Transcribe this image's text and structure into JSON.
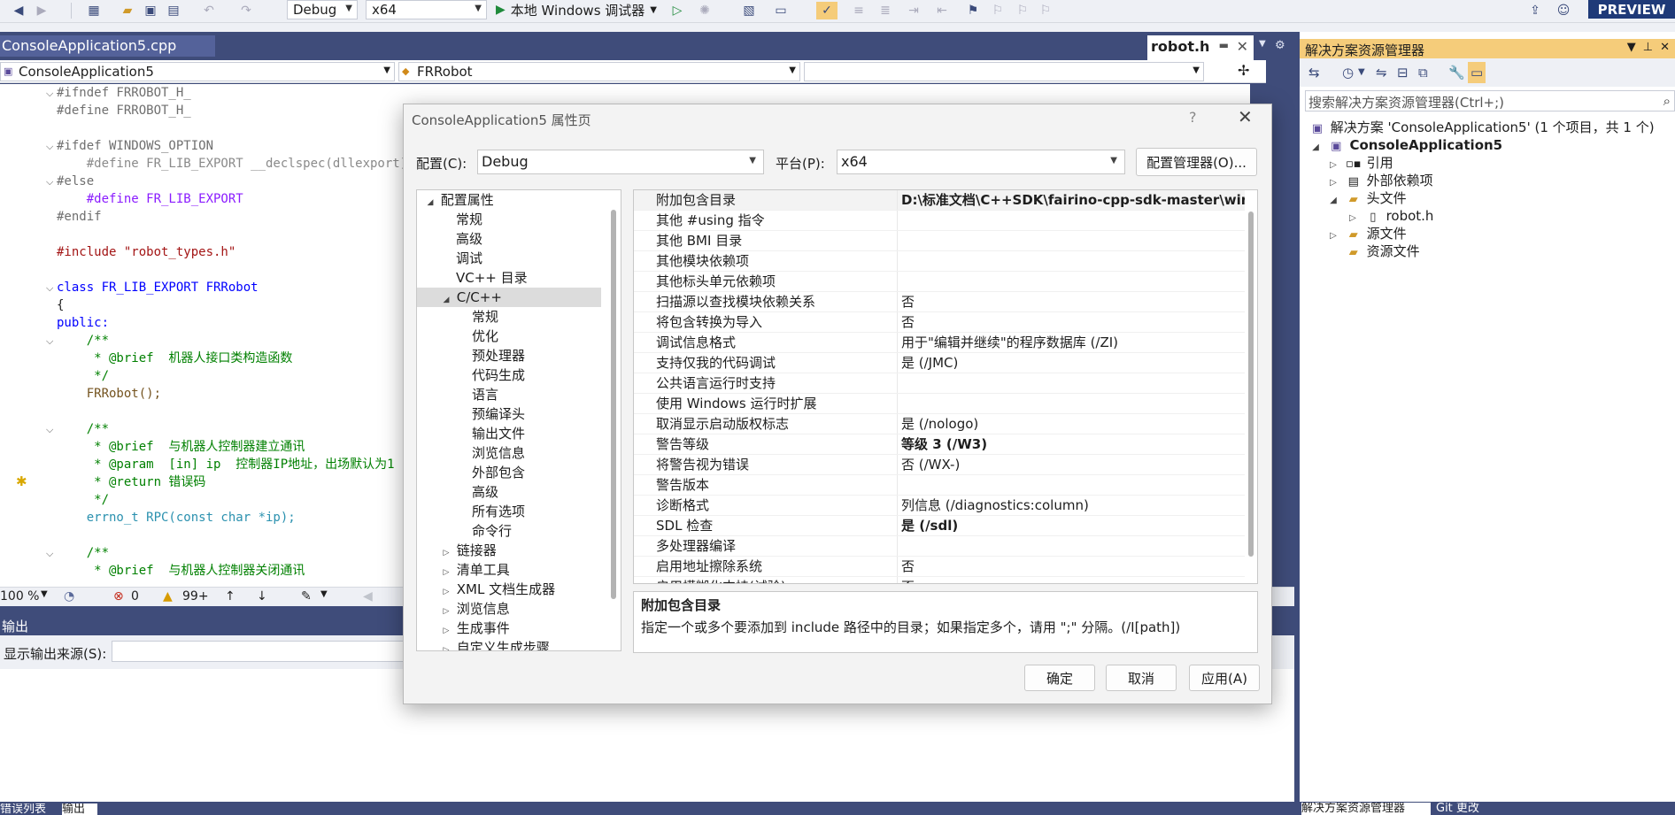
{
  "toolbar": {
    "config": "Debug",
    "platform": "x64",
    "debug_start": "本地 Windows 调试器",
    "preview": "PREVIEW"
  },
  "editor": {
    "tabs": {
      "main": "ConsoleApplication5.cpp",
      "robot": "robot.h"
    },
    "nav": {
      "project": "ConsoleApplication5",
      "scope": "FRRobot",
      "member": ""
    },
    "status": {
      "zoom": "100 %",
      "errors": "0",
      "warnings": "99+"
    }
  },
  "code": [
    "#ifndef FRROBOT_H_",
    "#define FRROBOT_H_",
    "",
    "#ifdef WINDOWS_OPTION",
    "    #define FR_LIB_EXPORT __declspec(dllexport)",
    "#else",
    "    #define FR_LIB_EXPORT",
    "#endif",
    "",
    "#include \"robot_types.h\"",
    "",
    "class FR_LIB_EXPORT FRRobot",
    "{",
    "public:",
    "    /**",
    "     * @brief  机器人接口类构造函数",
    "     */",
    "    FRRobot();",
    "",
    "    /**",
    "     * @brief  与机器人控制器建立通讯",
    "     * @param  [in] ip  控制器IP地址，出场默认为1",
    "     * @return 错误码",
    "     */",
    "    errno_t RPC(const char *ip);",
    "",
    "    /**",
    "     * @brief  与机器人控制器关闭通讯"
  ],
  "output": {
    "title": "输出",
    "source_label": "显示输出来源(S):",
    "tabs": [
      "错误列表",
      "输出"
    ]
  },
  "solution_explorer": {
    "title": "解决方案资源管理器",
    "search_placeholder": "搜索解决方案资源管理器(Ctrl+;)",
    "tree": [
      {
        "label": "解决方案 'ConsoleApplication5' (1 个项目，共 1 个)",
        "level": 0,
        "icon": "solution-icon"
      },
      {
        "label": "ConsoleApplication5",
        "level": 1,
        "icon": "project-icon",
        "expanded": true,
        "bold": true
      },
      {
        "label": "引用",
        "level": 2,
        "icon": "references-icon",
        "expanded": false
      },
      {
        "label": "外部依赖项",
        "level": 2,
        "icon": "external-deps-icon",
        "expanded": false
      },
      {
        "label": "头文件",
        "level": 2,
        "icon": "folder-icon",
        "expanded": true
      },
      {
        "label": "robot.h",
        "level": 3,
        "icon": "header-file-icon",
        "expanded": false
      },
      {
        "label": "源文件",
        "level": 2,
        "icon": "folder-icon",
        "expanded": false
      },
      {
        "label": "资源文件",
        "level": 2,
        "icon": "folder-icon"
      }
    ],
    "bottom_tabs": [
      "解决方案资源管理器",
      "Git 更改"
    ]
  },
  "dialog": {
    "title": "ConsoleApplication5 属性页",
    "config_label": "配置(C):",
    "config_value": "Debug",
    "platform_label": "平台(P):",
    "platform_value": "x64",
    "config_manager": "配置管理器(O)...",
    "tree": [
      {
        "label": "配置属性",
        "level": 0,
        "expanded": true
      },
      {
        "label": "常规",
        "level": 1
      },
      {
        "label": "高级",
        "level": 1
      },
      {
        "label": "调试",
        "level": 1
      },
      {
        "label": "VC++ 目录",
        "level": 1
      },
      {
        "label": "C/C++",
        "level": 1,
        "expanded": true,
        "selected": true
      },
      {
        "label": "常规",
        "level": 2
      },
      {
        "label": "优化",
        "level": 2
      },
      {
        "label": "预处理器",
        "level": 2
      },
      {
        "label": "代码生成",
        "level": 2
      },
      {
        "label": "语言",
        "level": 2
      },
      {
        "label": "预编译头",
        "level": 2
      },
      {
        "label": "输出文件",
        "level": 2
      },
      {
        "label": "浏览信息",
        "level": 2
      },
      {
        "label": "外部包含",
        "level": 2
      },
      {
        "label": "高级",
        "level": 2
      },
      {
        "label": "所有选项",
        "level": 2
      },
      {
        "label": "命令行",
        "level": 2
      },
      {
        "label": "链接器",
        "level": 1,
        "expanded": false
      },
      {
        "label": "清单工具",
        "level": 1,
        "expanded": false
      },
      {
        "label": "XML 文档生成器",
        "level": 1,
        "expanded": false
      },
      {
        "label": "浏览信息",
        "level": 1,
        "expanded": false
      },
      {
        "label": "生成事件",
        "level": 1,
        "expanded": false
      },
      {
        "label": "自定义生成步骤",
        "level": 1,
        "expanded": false
      }
    ],
    "properties": [
      {
        "name": "附加包含目录",
        "value": "D:\\标准文档\\C++SDK\\fairino-cpp-sdk-master\\window",
        "bold": true,
        "selected": true
      },
      {
        "name": "其他 #using 指令",
        "value": ""
      },
      {
        "name": "其他 BMI 目录",
        "value": ""
      },
      {
        "name": "其他模块依赖项",
        "value": ""
      },
      {
        "name": "其他标头单元依赖项",
        "value": ""
      },
      {
        "name": "扫描源以查找模块依赖关系",
        "value": "否"
      },
      {
        "name": "将包含转换为导入",
        "value": "否"
      },
      {
        "name": "调试信息格式",
        "value": "用于\"编辑并继续\"的程序数据库 (/ZI)"
      },
      {
        "name": "支持仅我的代码调试",
        "value": "是 (/JMC)"
      },
      {
        "name": "公共语言运行时支持",
        "value": ""
      },
      {
        "name": "使用 Windows 运行时扩展",
        "value": ""
      },
      {
        "name": "取消显示启动版权标志",
        "value": "是 (/nologo)"
      },
      {
        "name": "警告等级",
        "value": "等级 3 (/W3)",
        "bold": true
      },
      {
        "name": "将警告视为错误",
        "value": "否 (/WX-)"
      },
      {
        "name": "警告版本",
        "value": ""
      },
      {
        "name": "诊断格式",
        "value": "列信息 (/diagnostics:column)"
      },
      {
        "name": "SDL 检查",
        "value": "是 (/sdl)",
        "bold": true
      },
      {
        "name": "多处理器编译",
        "value": ""
      },
      {
        "name": "启用地址擦除系统",
        "value": "否"
      },
      {
        "name": "启用模糊化支持(试验)",
        "value": "否"
      }
    ],
    "description": {
      "title": "附加包含目录",
      "text": "指定一个或多个要添加到 include 路径中的目录；如果指定多个，请用 \";\" 分隔。(/I[path])"
    },
    "buttons": {
      "ok": "确定",
      "cancel": "取消",
      "apply": "应用(A)"
    }
  }
}
